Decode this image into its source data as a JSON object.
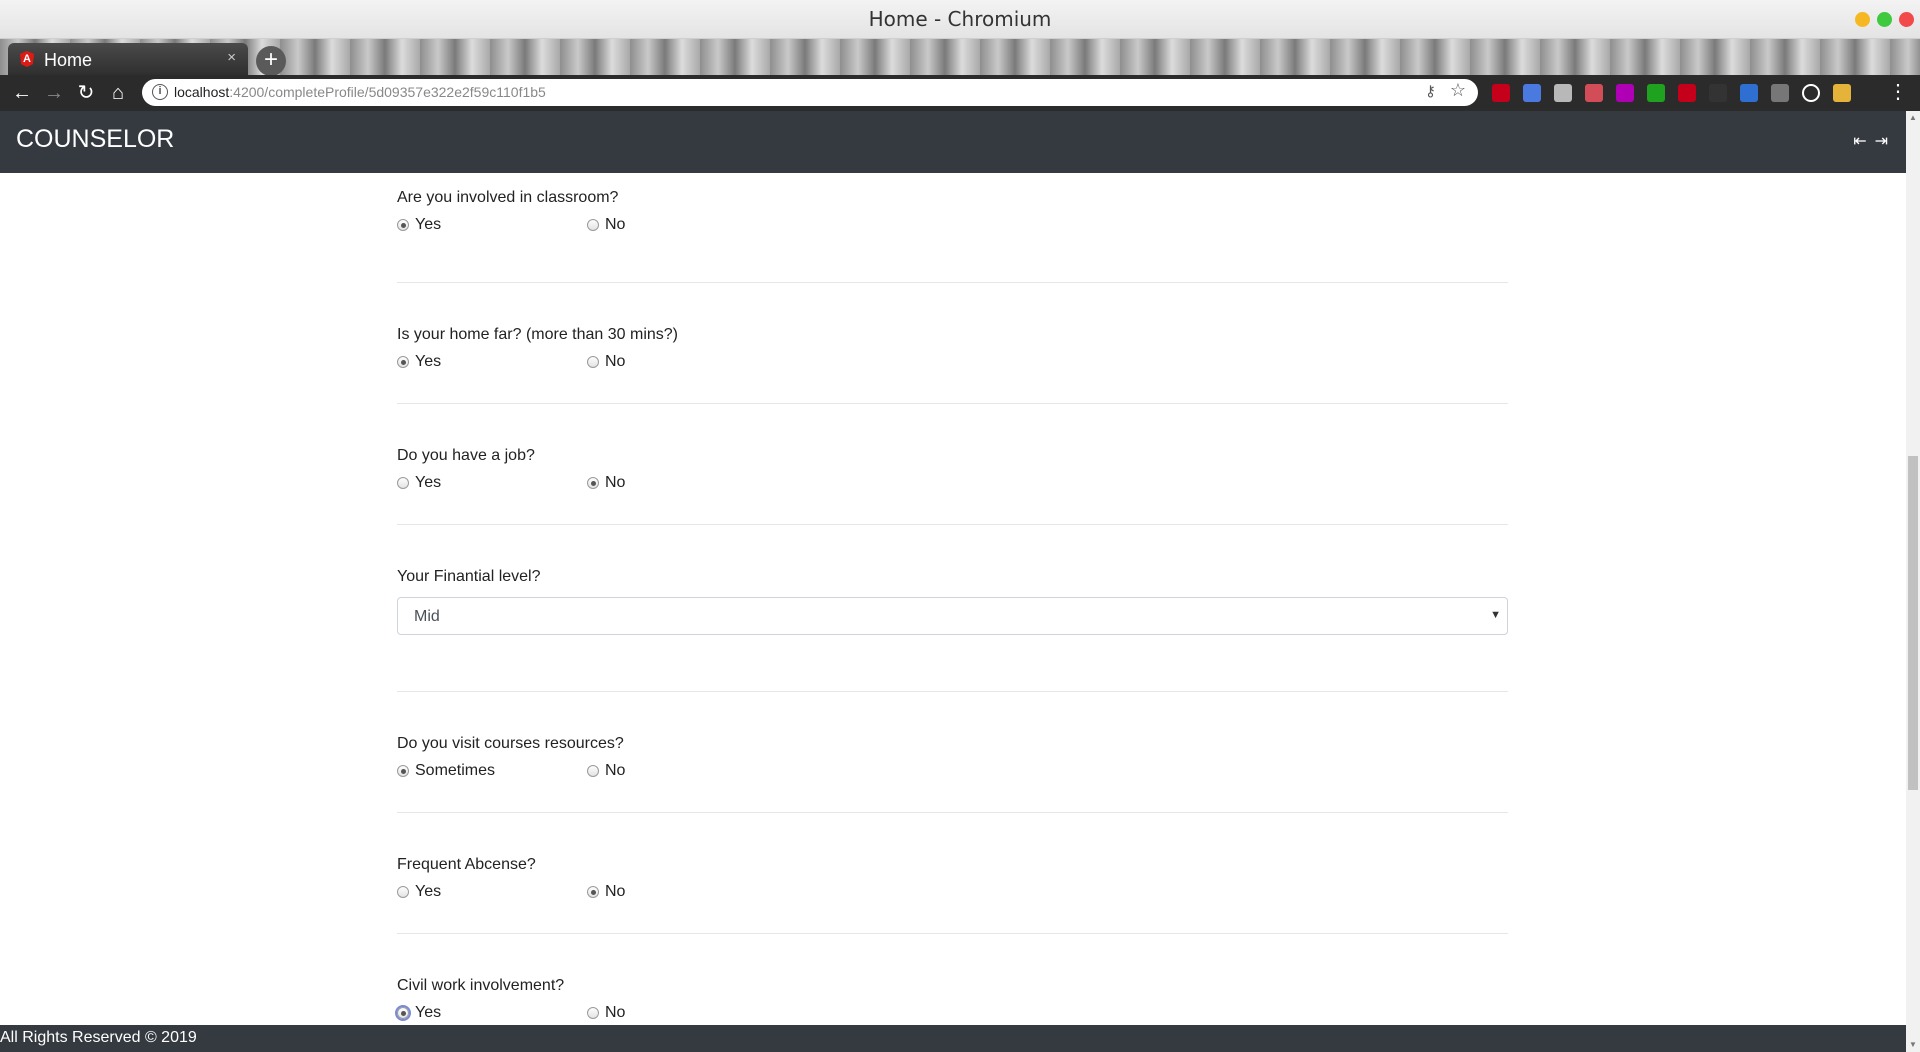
{
  "window": {
    "title": "Home - Chromium"
  },
  "tab": {
    "title": "Home",
    "favicon": "A",
    "close": "×"
  },
  "newtab": "+",
  "address": {
    "host": "localhost",
    "rest": ":4200/completeProfile/5d09357e322e2f59c110f1b5"
  },
  "extensions": [
    "#c4001a",
    "#4a7ae0",
    "#b8b8b8",
    "#d24d57",
    "#b000b5",
    "#1fa21f",
    "#c4001a",
    "#333333",
    "#2f6fd1",
    "#777777",
    "#ffffff",
    "#e6b33a"
  ],
  "app": {
    "brand": "COUNSELOR"
  },
  "questions": [
    {
      "label": "Are you involved in classroom?",
      "options": [
        "Yes",
        "No"
      ],
      "selected": 0
    },
    {
      "label": "Is your home far? (more than 30 mins?)",
      "options": [
        "Yes",
        "No"
      ],
      "selected": 0
    },
    {
      "label": "Do you have a job?",
      "options": [
        "Yes",
        "No"
      ],
      "selected": 1
    },
    {
      "label": "Your Finantial level?",
      "type": "select",
      "value": "Mid"
    },
    {
      "label": "Do you visit courses resources?",
      "options": [
        "Sometimes",
        "No"
      ],
      "selected": 0
    },
    {
      "label": "Frequent Abcense?",
      "options": [
        "Yes",
        "No"
      ],
      "selected": 1
    },
    {
      "label": "Civil work involvement?",
      "options": [
        "Yes",
        "No"
      ],
      "selected": 0,
      "focused": true
    }
  ],
  "footer": {
    "text": "All Rights Reserved © 2019"
  }
}
